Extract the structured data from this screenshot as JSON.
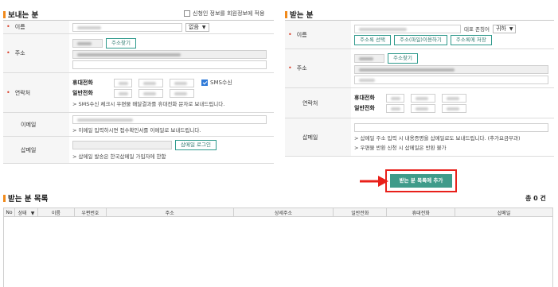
{
  "sender": {
    "title": "보내는 분",
    "save_option": "신청인 정보를 회원정보에 적용",
    "name_label": "이름",
    "name_suffix": "없음",
    "address_label": "주소",
    "find_address_button": "주소찾기",
    "contact_label": "연락처",
    "mobile_label": "휴대전화",
    "phone_label": "일반전화",
    "sms_label": "SMS수신",
    "sms_note": "SMS수신 체크시 우편물 배달결과를 휴대전화 문자로 보내드립니다.",
    "email_label": "이메일",
    "email_note": "이메일 입력하시면 접수확인서를 이메일로 보내드립니다.",
    "semail_label": "삽메일",
    "semail_login_button": "삽메일 로그인",
    "semail_note": "삽메일 발송은 한국삽메일 가입자에 한함"
  },
  "receiver": {
    "title": "받는 분",
    "name_label": "이름",
    "title_label": "대표 존칭어",
    "title_value": "귀하",
    "addressbook_select_button": "주소록 선택",
    "addressbook_file_button": "주소(파일)이용하기",
    "addressbook_save_button": "주소록에 저장",
    "address_label": "주소",
    "find_address_button": "주소찾기",
    "contact_label": "연락처",
    "mobile_label": "휴대전화",
    "phone_label": "일반전화",
    "semail_label": "삽메일",
    "semail_note1": "삽메일 주소 입력 시 내용증명을 삽메일로도 보내드립니다. (추가요금부과)",
    "semail_note2": "우편물 반환 신청 시 삽메일은 반환 불가",
    "add_button": "받는 분 목록에 추가"
  },
  "list": {
    "title": "받는 분 목록",
    "count": "총 0 건",
    "columns": [
      "No",
      "상태",
      "이름",
      "우편번호",
      "주소",
      "상세주소",
      "일반전화",
      "휴대전화",
      "삽메일"
    ]
  },
  "colors": {
    "accent": "#f08a1c",
    "teal": "#3f9b8a",
    "highlight": "#e8201a"
  }
}
